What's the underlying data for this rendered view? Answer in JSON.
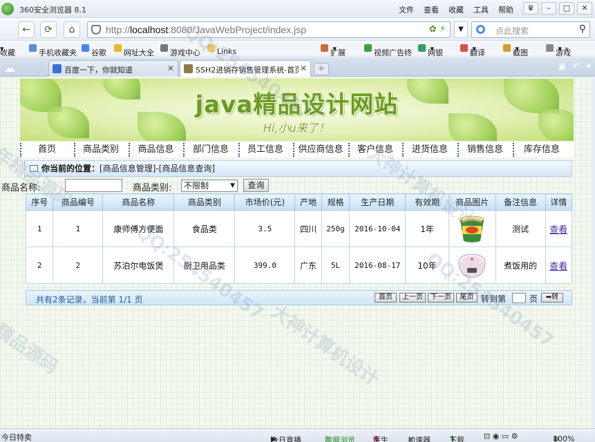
{
  "browser": {
    "app_title": "360安全浏览器 8.1",
    "menu": [
      "文件",
      "查看",
      "收藏",
      "工具",
      "帮助"
    ],
    "url_prefix": "http://",
    "url_host": "localhost",
    "url_rest": ":8080/JavaWebProject/index.jsp",
    "search_placeholder": "点此搜索",
    "bookmarks": [
      "收藏",
      "手机收藏夹",
      "谷歌",
      "网址大全",
      "游戏中心",
      "Links",
      "扩展",
      "视频广告终",
      "网银",
      "翻译",
      "截图",
      "游戏"
    ],
    "tabs": [
      {
        "label": "百度一下，你就知道",
        "active": false
      },
      {
        "label": "SSH2进销存销售管理系统-首页",
        "active": true
      }
    ],
    "status": {
      "left": "今日特卖",
      "items": [
        "今日直播",
        "跨屏浏览",
        "医生",
        "加速器",
        "下载"
      ],
      "zoom": "100%"
    }
  },
  "site": {
    "title": "java精品设计网站",
    "slogan": "Hi,小u来了！",
    "nav": [
      "首页",
      "商品类别",
      "商品信息",
      "部门信息",
      "员工信息",
      "供应商信息",
      "客户信息",
      "进货信息",
      "销售信息",
      "库存信息"
    ]
  },
  "location": {
    "label": "你当前的位置：",
    "path": "[商品信息管理]-[商品信息查询]"
  },
  "filter": {
    "name_label": "商品名称:",
    "name_value": "",
    "category_label": "商品类别:",
    "category_selected": "不限制",
    "query_button": "查询"
  },
  "table": {
    "headers": [
      "序号",
      "商品编号",
      "商品名称",
      "商品类别",
      "市场价(元)",
      "产地",
      "规格",
      "生产日期",
      "有效期",
      "商品图片",
      "备注信息",
      "详情"
    ],
    "rows": [
      {
        "index": "1",
        "code": "1",
        "name": "康师傅方便面",
        "category": "食品类",
        "price": "3.5",
        "origin": "四川",
        "spec": "250g",
        "date": "2016-10-04",
        "validity": "1年",
        "image": "instant-noodle-cup",
        "remark": "测试",
        "detail": "查看"
      },
      {
        "index": "2",
        "code": "2",
        "name": "苏泊尔电饭煲",
        "category": "厨卫用品类",
        "price": "399.0",
        "origin": "广东",
        "spec": "5L",
        "date": "2016-08-17",
        "validity": "10年",
        "image": "rice-cooker",
        "remark": "煮饭用的",
        "detail": "查看"
      }
    ]
  },
  "pager": {
    "summary": "共有2条记录，当前第 1/1 页",
    "first": "首页",
    "prev": "上一页",
    "next": "下一页",
    "last": "尾页",
    "goto_label": "转到第",
    "page_unit": "页",
    "go_button": "➡转"
  },
  "watermark": [
    "QQ:254540457",
    "大神计算机设计",
    "常年精品源码",
    "360安全浏览器"
  ]
}
